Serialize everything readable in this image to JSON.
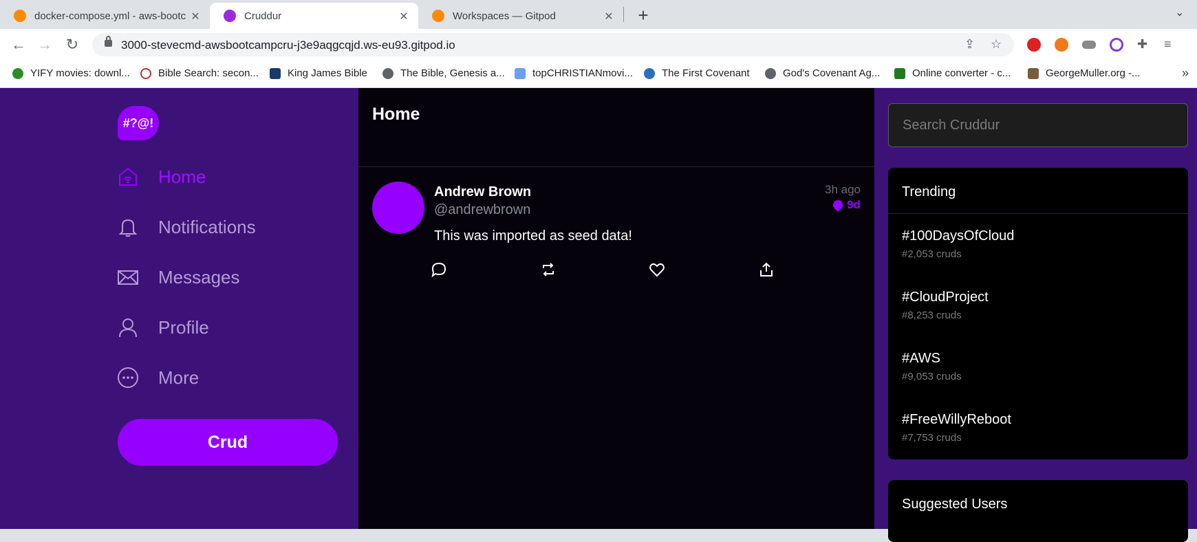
{
  "browser": {
    "tabs": [
      {
        "title": "docker-compose.yml - aws-bootc",
        "close": "✕"
      },
      {
        "title": "Cruddur",
        "close": "✕"
      },
      {
        "title": "Workspaces — Gitpod",
        "close": "✕"
      }
    ],
    "new_tab": "+",
    "tab_menu": "⌄",
    "url": "3000-stevecmd-awsbootcampcru-j3e9aqgcqjd.ws-eu93.gitpod.io",
    "bookmarks": [
      {
        "label": "YIFY movies: downl...",
        "color": "#2a8d2a"
      },
      {
        "label": "Bible Search: secon...",
        "color": "#b33"
      },
      {
        "label": "King James Bible",
        "color": "#1b3a6b"
      },
      {
        "label": "The Bible, Genesis a...",
        "color": "#5f6368"
      },
      {
        "label": "topCHRISTIANmovi...",
        "color": "#6aa0f0"
      },
      {
        "label": "The First Covenant",
        "color": "#2a6fc0"
      },
      {
        "label": "God's Covenant Ag...",
        "color": "#5f6368"
      },
      {
        "label": "Online converter - c...",
        "color": "#1f7a1f"
      },
      {
        "label": "GeorgeMuller.org -...",
        "color": "#7a5c3a"
      }
    ],
    "bookmarks_more": "»"
  },
  "sidebar": {
    "logo_text": "#?@!",
    "items": [
      {
        "label": "Home",
        "icon": "home-icon"
      },
      {
        "label": "Notifications",
        "icon": "bell-icon"
      },
      {
        "label": "Messages",
        "icon": "mail-icon"
      },
      {
        "label": "Profile",
        "icon": "user-icon"
      },
      {
        "label": "More",
        "icon": "more-icon"
      }
    ],
    "crud_label": "Crud"
  },
  "feed": {
    "title": "Home",
    "posts": [
      {
        "display_name": "Andrew Brown",
        "handle": "@andrewbrown",
        "time_ago": "3h ago",
        "expires": "9d",
        "message": "This was imported as seed data!"
      }
    ]
  },
  "right": {
    "search_placeholder": "Search Cruddur",
    "trending_title": "Trending",
    "trends": [
      {
        "name": "#100DaysOfCloud",
        "count": "#2,053 cruds"
      },
      {
        "name": "#CloudProject",
        "count": "#8,253 cruds"
      },
      {
        "name": "#AWS",
        "count": "#9,053 cruds"
      },
      {
        "name": "#FreeWillyReboot",
        "count": "#7,753 cruds"
      }
    ],
    "suggested_title": "Suggested Users"
  },
  "colors": {
    "brand": "#9500ff",
    "sidebar_bg": "#3d1278",
    "feed_bg": "#05020c"
  }
}
